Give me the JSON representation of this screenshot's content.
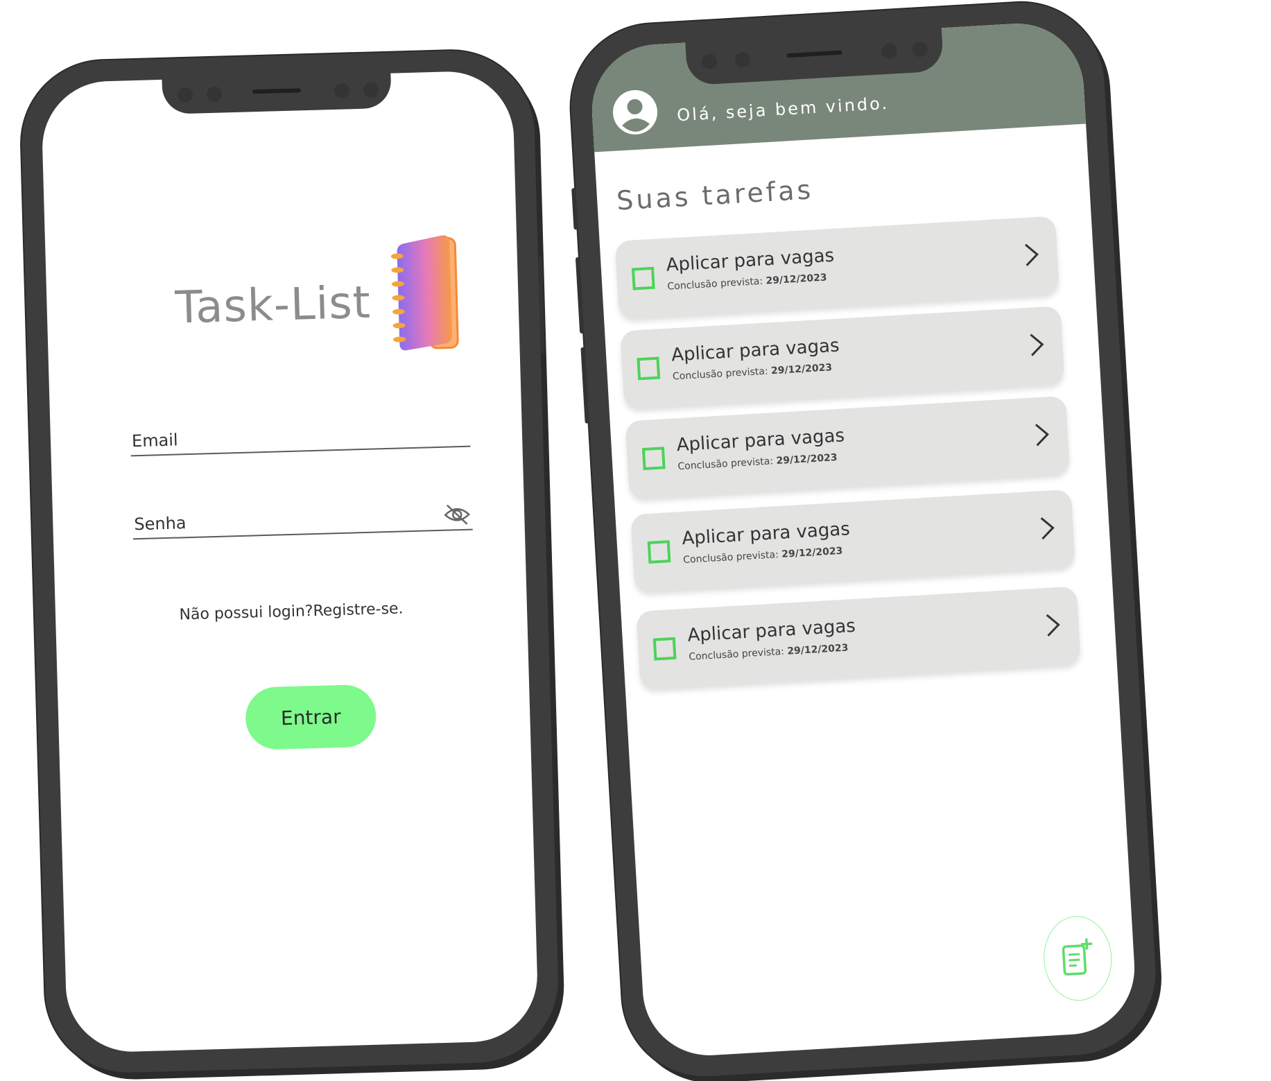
{
  "login": {
    "app_title": "Task-List",
    "email_label": "Email",
    "password_label": "Senha",
    "register_text": "Não possui login?Registre-se.",
    "enter_button": "Entrar",
    "icons": [
      "notebook-logo-icon",
      "eye-off-icon"
    ]
  },
  "tasks_screen": {
    "greeting": "Olá, seja bem vindo.",
    "section_title": "Suas tarefas",
    "tasks": [
      {
        "title": "Aplicar para vagas",
        "due_label": "Conclusão prevista:",
        "due_date": "29/12/2023"
      },
      {
        "title": "Aplicar para vagas",
        "due_label": "Conclusão prevista:",
        "due_date": "29/12/2023"
      },
      {
        "title": "Aplicar para vagas",
        "due_label": "Conclusão prevista:",
        "due_date": "29/12/2023"
      },
      {
        "title": "Aplicar para vagas",
        "due_label": "Conclusão prevista:",
        "due_date": "29/12/2023"
      },
      {
        "title": "Aplicar para vagas",
        "due_label": "Conclusão prevista:",
        "due_date": "29/12/2023"
      }
    ],
    "icons": [
      "user-avatar-icon",
      "checkbox-icon",
      "chevron-right-icon",
      "add-note-icon"
    ]
  },
  "colors": {
    "accent_green": "#7ef98b",
    "checkbox_green": "#4cd35a",
    "header_bg": "#79877a",
    "card_bg": "#e3e4e2",
    "phone_frame": "#3d3d3d"
  }
}
